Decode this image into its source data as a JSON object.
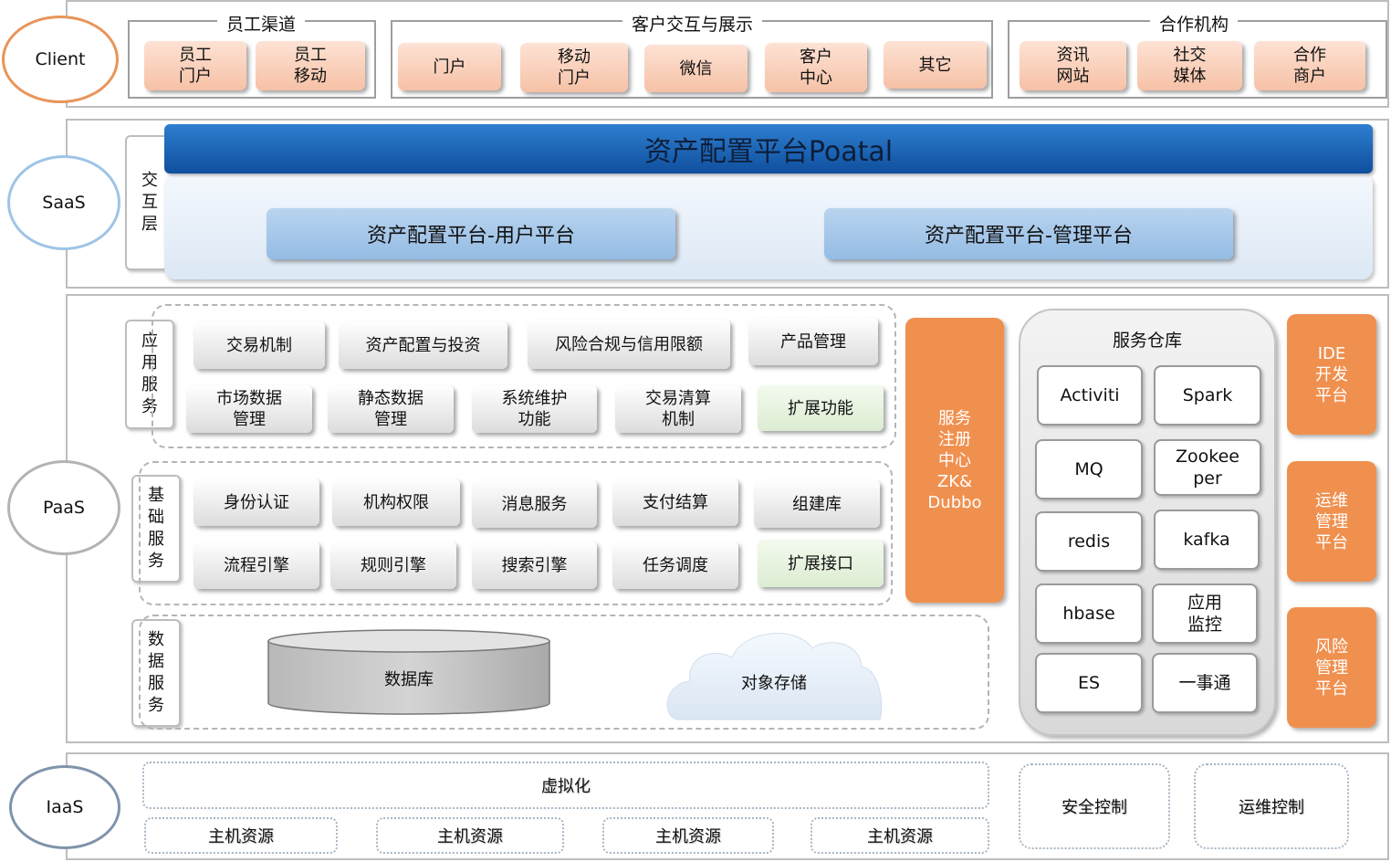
{
  "layers": {
    "client": "Client",
    "saas": "SaaS",
    "paas": "PaaS",
    "iaas": "IaaS"
  },
  "colors": {
    "client_ring": "#e8955a",
    "saas_ring": "#9fc4e6",
    "paas_ring": "#b3b3b3",
    "iaas_ring": "#7f93aa",
    "portal_bar": "#1a63b8",
    "orange_box": "#f0904f",
    "peach_box": "#f6c1a6"
  },
  "client": {
    "groups": [
      {
        "title": "员工渠道",
        "items": [
          "员工\n门户",
          "员工\n移动"
        ]
      },
      {
        "title": "客户交互与展示",
        "items": [
          "门户",
          "移动\n门户",
          "微信",
          "客户\n中心",
          "其它"
        ]
      },
      {
        "title": "合作机构",
        "items": [
          "资讯\n网站",
          "社交\n媒体",
          "合作\n商户"
        ]
      }
    ]
  },
  "saas": {
    "side_label": "交\n互\n层",
    "portal_title": "资产配置平台Poatal",
    "user_platform": "资产配置平台-用户平台",
    "admin_platform": "资产配置平台-管理平台"
  },
  "paas": {
    "app_services": {
      "label": "应\n用\n服\n务",
      "row1": [
        "交易机制",
        "资产配置与投资",
        "风险合规与信用限额",
        "产品管理"
      ],
      "row2": [
        "市场数据\n管理",
        "静态数据\n管理",
        "系统维护\n功能",
        "交易清算\n机制",
        "扩展功能"
      ]
    },
    "basic_services": {
      "label": "基\n础\n服\n务",
      "row1": [
        "身份认证",
        "机构权限",
        "消息服务",
        "支付结算",
        "组建库"
      ],
      "row2": [
        "流程引擎",
        "规则引擎",
        "搜索引擎",
        "任务调度",
        "扩展接口"
      ]
    },
    "data_services": {
      "label": "数\n据\n服\n务",
      "database": "数据库",
      "object_storage": "对象存储"
    },
    "registry": "服务\n注册\n中心\nZK&\nDubbo",
    "warehouse": {
      "title": "服务仓库",
      "items": [
        "Activiti",
        "Spark",
        "MQ",
        "Zookee\nper",
        "redis",
        "kafka",
        "hbase",
        "应用\n监控",
        "ES",
        "一事通"
      ]
    },
    "side_platforms": [
      "IDE\n开发\n平台",
      "运维\n管理\n平台",
      "风险\n管理\n平台"
    ]
  },
  "iaas": {
    "virtualization": "虚拟化",
    "hosts": [
      "主机资源",
      "主机资源",
      "主机资源",
      "主机资源"
    ],
    "security": "安全控制",
    "ops": "运维控制"
  }
}
